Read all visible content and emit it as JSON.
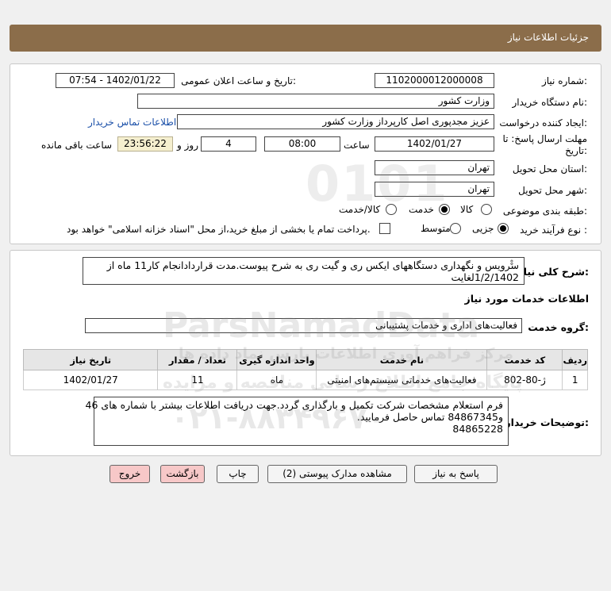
{
  "header": {
    "title": "جزئیات اطلاعات نیاز"
  },
  "form": {
    "need_number_label": "شماره نیاز:",
    "need_number": "1102000012000008",
    "announce_label": "تاریخ و ساعت اعلان عمومی:",
    "announce_value": "1402/01/22 - 07:54",
    "buyer_org_label": "نام دستگاه خریدار:",
    "buyer_org": "وزارت کشور",
    "requester_label": "ایجاد کننده درخواست:",
    "requester": "عزیز مجدپوری اصل کارپرداز وزارت کشور",
    "contact_link": "اطلاعات تماس خریدار",
    "deadline_label_1": "مهلت ارسال پاسخ: تا",
    "deadline_label_2": "تاریخ:",
    "deadline_date": "1402/01/27",
    "time_label": "ساعت",
    "deadline_time": "08:00",
    "days_value": "4",
    "days_label": "روز و",
    "remaining_time": "23:56:22",
    "remaining_label": "ساعت باقی مانده",
    "province_label": "استان محل تحویل:",
    "province": "تهران",
    "city_label": "شهر محل تحویل:",
    "city": "تهران",
    "category_label": "طبقه بندی موضوعی:",
    "category_options": [
      "کالا",
      "خدمت",
      "کالا/خدمت"
    ],
    "category_selected": "خدمت",
    "process_label": "نوع فرآیند خرید :",
    "process_options": [
      "جزیی",
      "متوسط"
    ],
    "process_selected": "جزیی",
    "payment_note": "پرداخت تمام یا بخشی از مبلغ خرید،از محل \"اسناد خزانه اسلامی\" خواهد بود."
  },
  "description": {
    "label": "شرح کلی نیاز:",
    "text": "سرویس و نگهداری دستگاههای ایکس ری و گیت ری به شرح پیوست.مدت قراردادانجام کار11 ماه از 1/2/1402لغایت"
  },
  "services": {
    "section_title": "اطلاعات خدمات مورد نیاز",
    "group_label": "گروه خدمت:",
    "group_value": "فعالیت‌های اداری و خدمات پشتیبانی",
    "table": {
      "headers": [
        "ردیف",
        "کد خدمت",
        "نام خدمت",
        "واحد اندازه گیری",
        "تعداد / مقدار",
        "تاریخ نیاز"
      ],
      "rows": [
        [
          "1",
          "ژ-80-802",
          "فعالیت‌های خدماتی سیستم‌های امنیتی",
          "ماه",
          "11",
          "1402/01/27"
        ]
      ]
    }
  },
  "buyer_notes": {
    "label": "توضیحات خریدار:",
    "line1": "فرم استعلام مشخصات شرکت تکمیل و بارگذاری گردد.جهت دریافت اطلاعات بیشتر با شماره های 46",
    "line2": "و84867345 تماس حاصل فرمایید.",
    "line3": "84865228"
  },
  "buttons": {
    "reply": "پاسخ به نیاز",
    "attachments": "مشاهده مدارک پیوستی (2)",
    "print": "چاپ",
    "back": "بازگشت",
    "exit": "خروج"
  },
  "watermark": {
    "digits": "0101",
    "brand": "ParsNamadData",
    "line1": "مرکز فراهم آوری اطلاعات پارس نماد داده ها",
    "line2": "پایگاه جامع اطلاع رسانی مناقصه و مزایده",
    "phone": "۰۲۱-۸۸۳۴۹۶۷۰"
  }
}
